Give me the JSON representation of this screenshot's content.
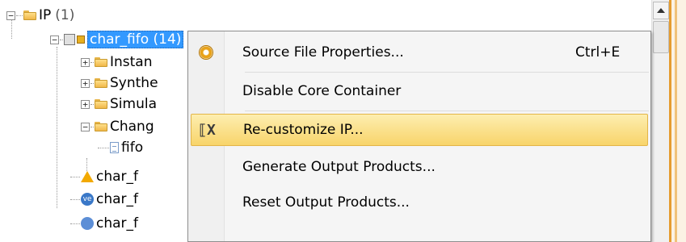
{
  "tree": {
    "root": {
      "label": "IP",
      "count": "(1)",
      "expander": "−"
    },
    "ip_item": {
      "label": "char_fifo (14)",
      "expander": "−"
    },
    "children": [
      {
        "label": "Instan",
        "expander": "+"
      },
      {
        "label": "Synthe",
        "expander": "+"
      },
      {
        "label": "Simula",
        "expander": "+"
      },
      {
        "label": "Chang",
        "expander": "−"
      }
    ],
    "change_child": {
      "label": "fifo"
    },
    "files": [
      {
        "label": "char_f",
        "icon": "triangle-icon"
      },
      {
        "label": "char_f",
        "icon": "ve-icon",
        "badge": "ve"
      },
      {
        "label": "char_f",
        "icon": "file-icon"
      }
    ]
  },
  "context_menu": {
    "items": [
      {
        "label": "Source File Properties...",
        "shortcut": "Ctrl+E",
        "icon": "gear-icon"
      },
      {
        "label": "Disable Core Container",
        "shortcut": "",
        "icon": ""
      },
      {
        "label": "Re-customize IP...",
        "shortcut": "",
        "icon": "recustomize-icon",
        "icon_glyph": "⟦X"
      },
      {
        "label": "Generate Output Products...",
        "shortcut": "",
        "icon": ""
      },
      {
        "label": "Reset Output Products...",
        "shortcut": "",
        "icon": ""
      }
    ]
  },
  "colors": {
    "selection": "#3399ff",
    "menu_highlight": "#f8d46a",
    "folder": "#f0b84a"
  }
}
